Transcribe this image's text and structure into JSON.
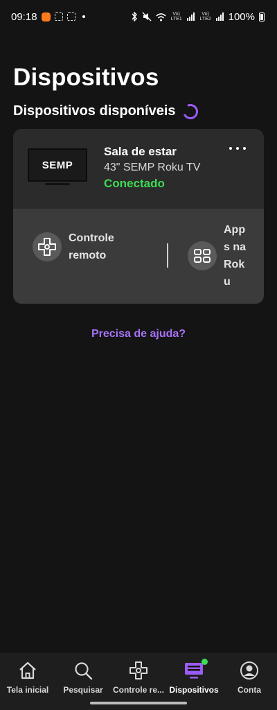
{
  "status_bar": {
    "time": "09:18",
    "battery": "100%",
    "net1": "Vo) LTE1",
    "net2": "Vo) LTE2"
  },
  "page": {
    "title": "Dispositivos",
    "section_title": "Dispositivos disponíveis"
  },
  "device": {
    "brand_logo": "SEMP",
    "name": "Sala de estar",
    "model": "43\" SEMP Roku TV",
    "status": "Conectado",
    "status_color": "#3ddc54",
    "actions": {
      "remote_label_1": "Controle",
      "remote_label_2": "remoto",
      "apps_label": "Apps na Roku"
    }
  },
  "help": {
    "label": "Precisa de ajuda?"
  },
  "nav": {
    "items": [
      {
        "label": "Tela inicial",
        "icon": "home-icon"
      },
      {
        "label": "Pesquisar",
        "icon": "search-icon"
      },
      {
        "label": "Controle re...",
        "icon": "remote-icon"
      },
      {
        "label": "Dispositivos",
        "icon": "tv-icon",
        "active": true
      },
      {
        "label": "Conta",
        "icon": "account-icon"
      }
    ]
  },
  "colors": {
    "accent": "#9b5cf6",
    "link": "#a772f6",
    "connected": "#3ddc54"
  }
}
